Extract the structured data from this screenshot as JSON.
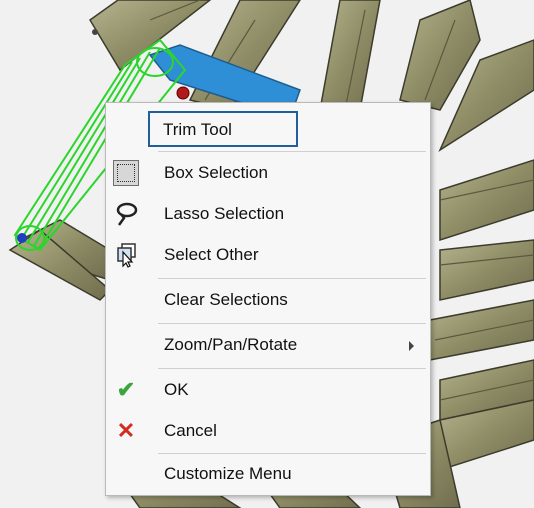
{
  "context_menu": {
    "items": [
      {
        "label": "Trim Tool",
        "icon": "none"
      },
      {
        "label": "Box Selection",
        "icon": "box-selection-icon"
      },
      {
        "label": "Lasso Selection",
        "icon": "lasso-icon"
      },
      {
        "label": "Select Other",
        "icon": "select-other-icon"
      },
      {
        "label": "Clear Selections",
        "icon": "none"
      },
      {
        "label": "Zoom/Pan/Rotate",
        "icon": "none",
        "submenu": true
      },
      {
        "label": "OK",
        "icon": "checkmark-icon"
      },
      {
        "label": "Cancel",
        "icon": "cancel-x-icon"
      },
      {
        "label": "Customize Menu",
        "icon": "none"
      }
    ]
  },
  "colors": {
    "highlight_frame": "#1f5f9a",
    "selection_green": "#2bd52b",
    "beam_olive": "#9c9a73",
    "accent_blue": "#2f8fd6",
    "ok_green": "#3aa53a",
    "cancel_red": "#d42b1e"
  }
}
